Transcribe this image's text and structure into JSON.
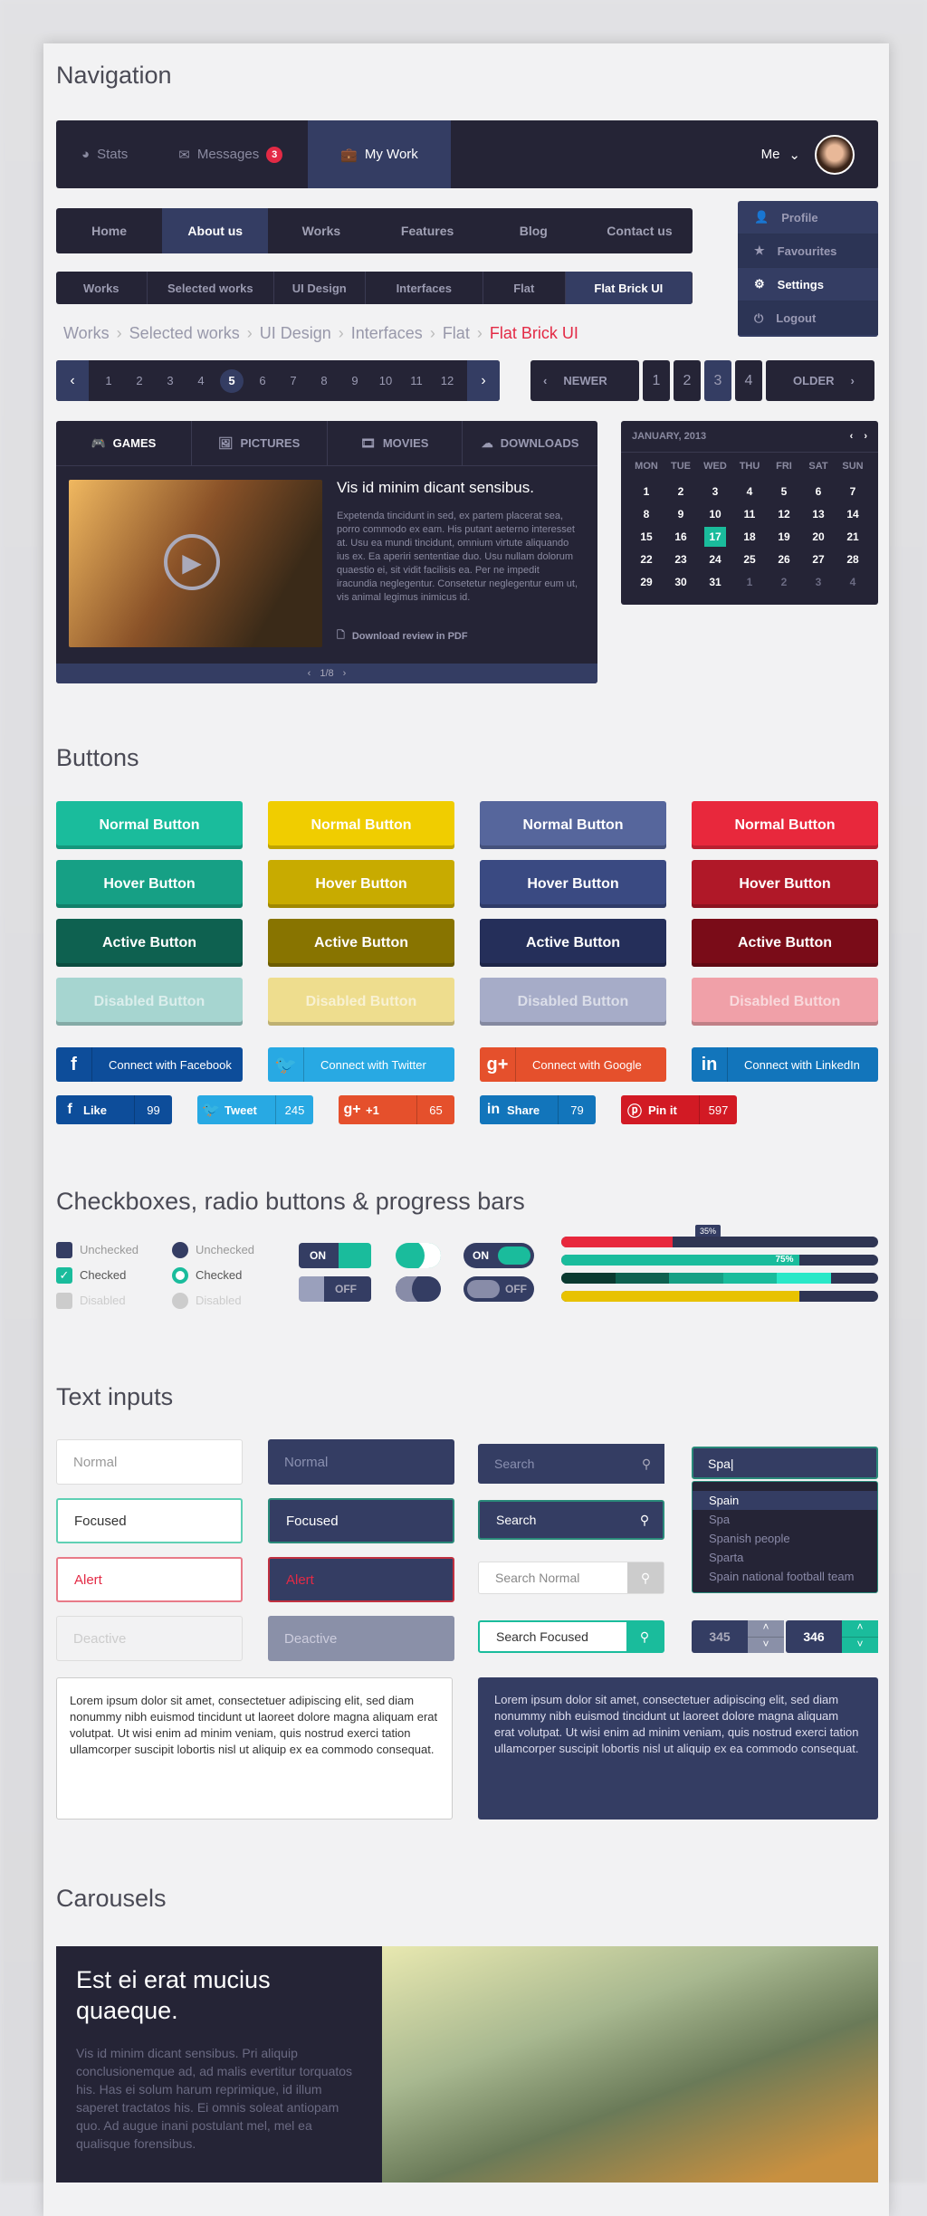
{
  "sections": {
    "navigation": "Navigation",
    "buttons": "Buttons",
    "checks": "Checkboxes, radio buttons & progress bars",
    "inputs": "Text inputs",
    "carousels": "Carousels"
  },
  "topnav": {
    "items": [
      {
        "label": "Stats",
        "icon": "pie-chart-icon"
      },
      {
        "label": "Messages",
        "icon": "envelope-icon",
        "badge": "3"
      },
      {
        "label": "My Work",
        "icon": "briefcase-icon",
        "active": true
      }
    ],
    "user": "Me"
  },
  "menu": {
    "items": [
      "Home",
      "About us",
      "Works",
      "Features",
      "Blog",
      "Contact us"
    ],
    "active": "About us"
  },
  "dropdown": {
    "items": [
      {
        "label": "Profile",
        "icon": "user-icon"
      },
      {
        "label": "Favourites",
        "icon": "star-icon"
      },
      {
        "label": "Settings",
        "icon": "gear-icon",
        "active": true
      },
      {
        "label": "Logout",
        "icon": "power-icon"
      }
    ]
  },
  "breadcrumb": [
    "Works",
    "Selected works",
    "UI Design",
    "Interfaces",
    "Flat",
    "Flat Brick UI"
  ],
  "pagination": {
    "pages": [
      "1",
      "2",
      "3",
      "4",
      "5",
      "6",
      "7",
      "8",
      "9",
      "10",
      "11",
      "12"
    ],
    "current": "5"
  },
  "pager": {
    "newer": "NEWER",
    "older": "OLDER",
    "pages": [
      "1",
      "2",
      "3",
      "4"
    ],
    "current": "3"
  },
  "tabs": {
    "items": [
      "GAMES",
      "PICTURES",
      "MOVIES",
      "DOWNLOADS"
    ],
    "title": "Vis id minim dicant sensibus.",
    "body": "Expetenda tincidunt in sed, ex partem placerat sea, porro commodo ex eam. His putant aeterno interesset at. Usu ea mundi tincidunt, omnium virtute aliquando ius ex. Ea aperiri sententiae duo. Usu nullam dolorum quaestio ei, sit vidit facilisis ea. Per ne impedit iracundia neglegentur. Consetetur neglegentur eum ut, vis animal legimus inimicus id.",
    "download": "Download review in PDF",
    "counter": "1/8"
  },
  "calendar": {
    "month": "JANUARY, 2013",
    "days": [
      "MON",
      "TUE",
      "WED",
      "THU",
      "FRI",
      "SAT",
      "SUN"
    ],
    "weeks": [
      [
        "1",
        "2",
        "3",
        "4",
        "5",
        "6",
        "7"
      ],
      [
        "8",
        "9",
        "10",
        "11",
        "12",
        "13",
        "14"
      ],
      [
        "15",
        "16",
        "17",
        "18",
        "19",
        "20",
        "21"
      ],
      [
        "22",
        "23",
        "24",
        "25",
        "26",
        "27",
        "28"
      ],
      [
        "29",
        "30",
        "31",
        "1",
        "2",
        "3",
        "4"
      ]
    ],
    "selected": "17"
  },
  "buttons": {
    "labels": [
      "Normal Button",
      "Hover Button",
      "Active Button",
      "Disabled Button"
    ],
    "colors": [
      [
        "#1abc9c",
        "#16a085",
        "#0e6150",
        "#a6d5d0"
      ],
      [
        "#f0cd00",
        "#c8ab00",
        "#887400",
        "#eedd8e"
      ],
      [
        "#56669c",
        "#3a4a82",
        "#252f5a",
        "#a6acc8"
      ],
      [
        "#e8283c",
        "#b01828",
        "#7a0c18",
        "#f0a0a8"
      ]
    ]
  },
  "social": {
    "connect": [
      {
        "label": "Connect with Facebook",
        "icon": "facebook-icon",
        "color": "#0d4d9a"
      },
      {
        "label": "Connect with Twitter",
        "icon": "twitter-icon",
        "color": "#28a9e3"
      },
      {
        "label": "Connect with Google",
        "icon": "google-plus-icon",
        "color": "#e5502c"
      },
      {
        "label": "Connect with LinkedIn",
        "icon": "linkedin-icon",
        "color": "#1275bb"
      }
    ],
    "share": [
      {
        "label": "Like",
        "count": "99",
        "icon": "facebook-icon",
        "color": "#0d4d9a"
      },
      {
        "label": "Tweet",
        "count": "245",
        "icon": "twitter-icon",
        "color": "#28a9e3"
      },
      {
        "label": "+1",
        "count": "65",
        "icon": "google-plus-icon",
        "color": "#e5502c"
      },
      {
        "label": "Share",
        "count": "79",
        "icon": "linkedin-icon",
        "color": "#1275bb"
      },
      {
        "label": "Pin it",
        "count": "597",
        "icon": "pinterest-icon",
        "color": "#d21a24"
      }
    ]
  },
  "checks": {
    "checkbox": [
      "Unchecked",
      "Checked",
      "Disabled"
    ],
    "radio": [
      "Unchecked",
      "Checked",
      "Disabled"
    ],
    "on": "ON",
    "off": "OFF"
  },
  "progress": {
    "bars": [
      {
        "value": 35,
        "color": "#e8283c",
        "label": "35%"
      },
      {
        "value": 75,
        "color": "#1abc9c",
        "label": "75%"
      },
      {
        "value": 85,
        "color": "#1abc9c"
      },
      {
        "value": 75,
        "color": "#e8c200"
      }
    ]
  },
  "inputs": {
    "light": [
      "Normal",
      "Focused",
      "Alert",
      "Deactive"
    ],
    "dark": [
      "Normal",
      "Focused",
      "Alert",
      "Deactive"
    ],
    "search": [
      "Search",
      "Search",
      "Search Normal",
      "Search Focused"
    ],
    "autocomplete": {
      "value": "Spa|",
      "options": [
        "Spain",
        "Spa",
        "Spanish people",
        "Sparta",
        "Spain national football team"
      ]
    },
    "stepper1": "345",
    "stepper2": "346"
  },
  "textarea": "Lorem ipsum dolor sit amet, consectetuer adipiscing elit, sed diam nonummy nibh euismod tincidunt ut laoreet dolore magna aliquam erat volutpat. Ut wisi enim ad minim veniam, quis nostrud exerci tation ullamcorper suscipit lobortis nisl ut aliquip ex ea commodo consequat.",
  "carousel": {
    "title": "Est ei erat mucius quaeque.",
    "body": "Vis id minim dicant sensibus. Pri aliquip conclusionemque ad, ad malis evertitur torquatos his. Has ei solum harum reprimique, id illum saperet tractatos his. Ei omnis soleat antiopam quo. Ad augue inani postulant mel, mel ea qualisque forensibus."
  }
}
